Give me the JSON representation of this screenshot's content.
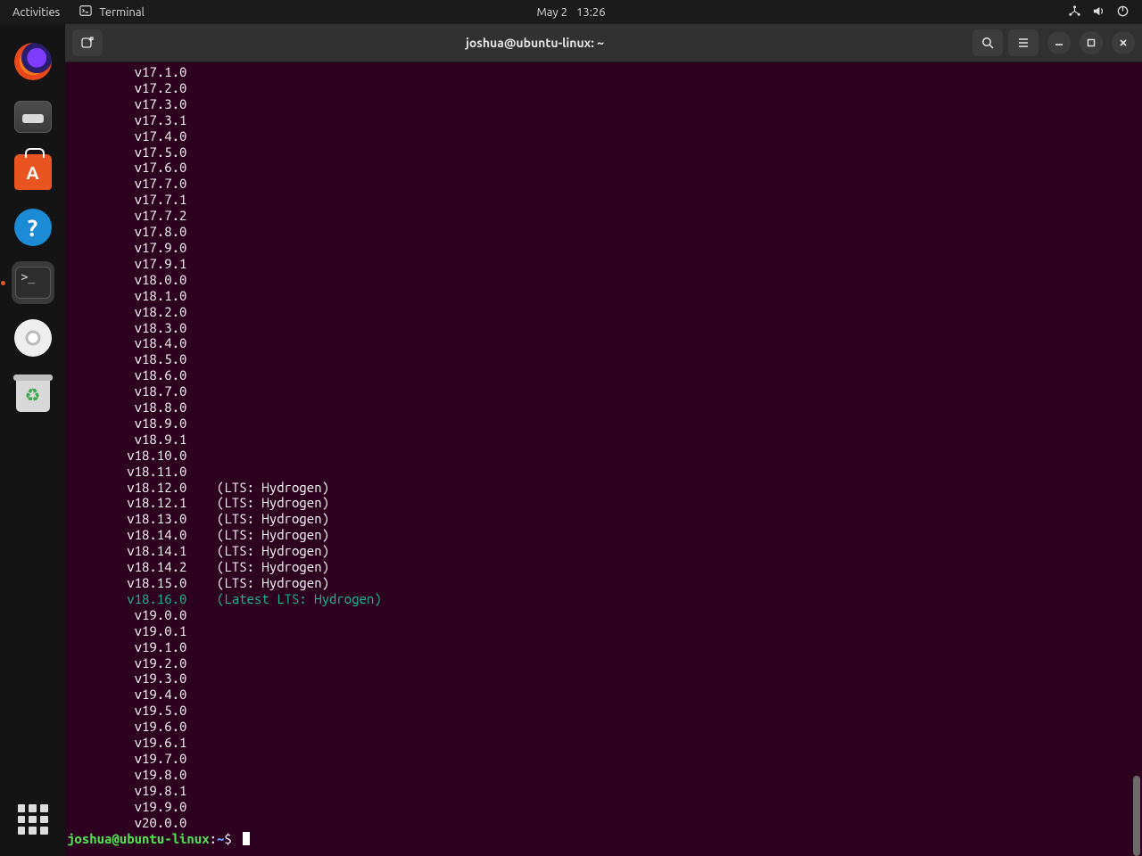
{
  "topbar": {
    "activities": "Activities",
    "app_label": "Terminal",
    "date": "May 2",
    "time": "13:26"
  },
  "dock": {
    "items": [
      {
        "name": "firefox"
      },
      {
        "name": "files"
      },
      {
        "name": "software"
      },
      {
        "name": "help"
      },
      {
        "name": "terminal",
        "active": true
      },
      {
        "name": "disc"
      },
      {
        "name": "trash"
      }
    ]
  },
  "terminal": {
    "title": "joshua@ubuntu-linux: ~",
    "prompt": {
      "user_host": "joshua@ubuntu-linux",
      "path": "~",
      "symbol": "$"
    },
    "lines": [
      {
        "v": "v17.1.0"
      },
      {
        "v": "v17.2.0"
      },
      {
        "v": "v17.3.0"
      },
      {
        "v": "v17.3.1"
      },
      {
        "v": "v17.4.0"
      },
      {
        "v": "v17.5.0"
      },
      {
        "v": "v17.6.0"
      },
      {
        "v": "v17.7.0"
      },
      {
        "v": "v17.7.1"
      },
      {
        "v": "v17.7.2"
      },
      {
        "v": "v17.8.0"
      },
      {
        "v": "v17.9.0"
      },
      {
        "v": "v17.9.1"
      },
      {
        "v": "v18.0.0"
      },
      {
        "v": "v18.1.0"
      },
      {
        "v": "v18.2.0"
      },
      {
        "v": "v18.3.0"
      },
      {
        "v": "v18.4.0"
      },
      {
        "v": "v18.5.0"
      },
      {
        "v": "v18.6.0"
      },
      {
        "v": "v18.7.0"
      },
      {
        "v": "v18.8.0"
      },
      {
        "v": "v18.9.0"
      },
      {
        "v": "v18.9.1"
      },
      {
        "v": "v18.10.0"
      },
      {
        "v": "v18.11.0"
      },
      {
        "v": "v18.12.0",
        "note": "(LTS: Hydrogen)"
      },
      {
        "v": "v18.12.1",
        "note": "(LTS: Hydrogen)"
      },
      {
        "v": "v18.13.0",
        "note": "(LTS: Hydrogen)"
      },
      {
        "v": "v18.14.0",
        "note": "(LTS: Hydrogen)"
      },
      {
        "v": "v18.14.1",
        "note": "(LTS: Hydrogen)"
      },
      {
        "v": "v18.14.2",
        "note": "(LTS: Hydrogen)"
      },
      {
        "v": "v18.15.0",
        "note": "(LTS: Hydrogen)"
      },
      {
        "v": "v18.16.0",
        "note": "(Latest LTS: Hydrogen)",
        "latest": true
      },
      {
        "v": "v19.0.0"
      },
      {
        "v": "v19.0.1"
      },
      {
        "v": "v19.1.0"
      },
      {
        "v": "v19.2.0"
      },
      {
        "v": "v19.3.0"
      },
      {
        "v": "v19.4.0"
      },
      {
        "v": "v19.5.0"
      },
      {
        "v": "v19.6.0"
      },
      {
        "v": "v19.6.1"
      },
      {
        "v": "v19.7.0"
      },
      {
        "v": "v19.8.0"
      },
      {
        "v": "v19.8.1"
      },
      {
        "v": "v19.9.0"
      },
      {
        "v": "v20.0.0"
      }
    ]
  }
}
